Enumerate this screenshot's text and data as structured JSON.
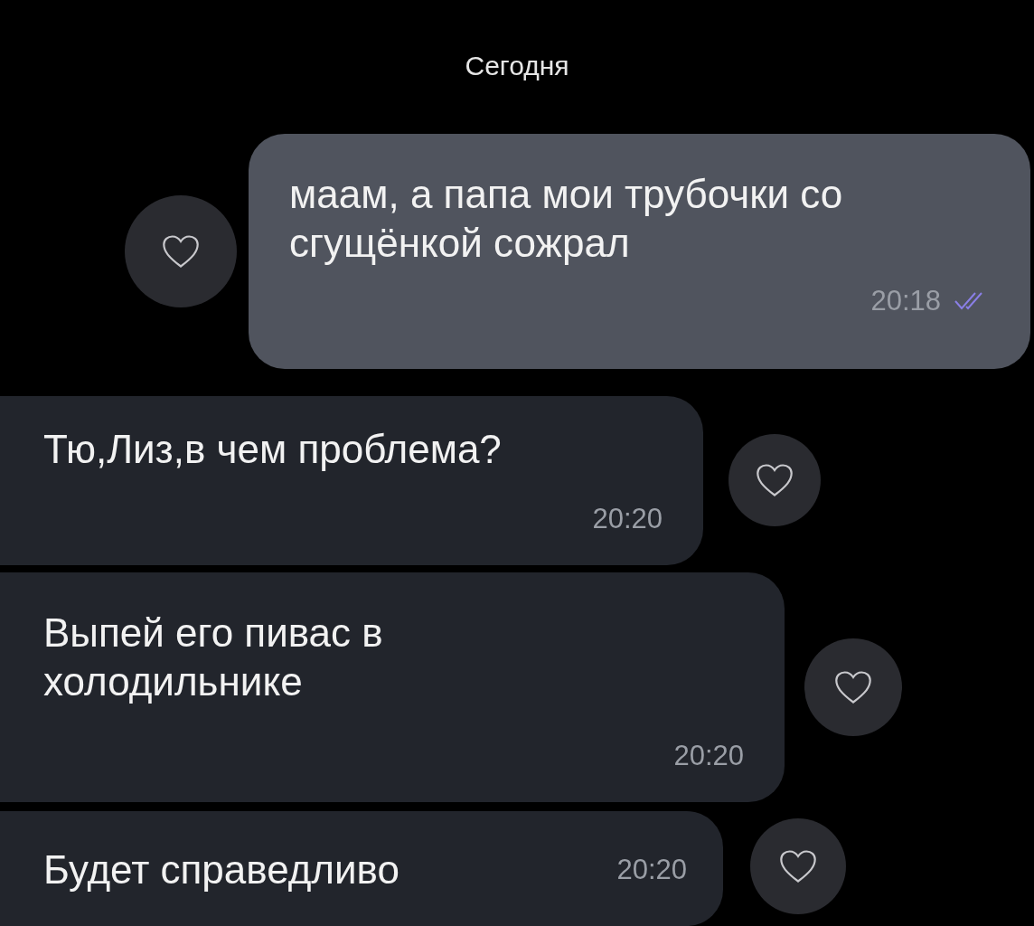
{
  "date_separator": "Сегодня",
  "messages": [
    {
      "kind": "outgoing",
      "text": "маам, а папа мои трубочки со сгущёнкой сожрал",
      "time": "20:18",
      "read": true
    },
    {
      "kind": "incoming",
      "text": "Тю,Лиз,в чем проблема?",
      "time": "20:20"
    },
    {
      "kind": "incoming",
      "text": "Выпей его пивас в холодильнике",
      "time": "20:20"
    },
    {
      "kind": "incoming",
      "text": "Будет справедливо",
      "time": "20:20"
    }
  ]
}
